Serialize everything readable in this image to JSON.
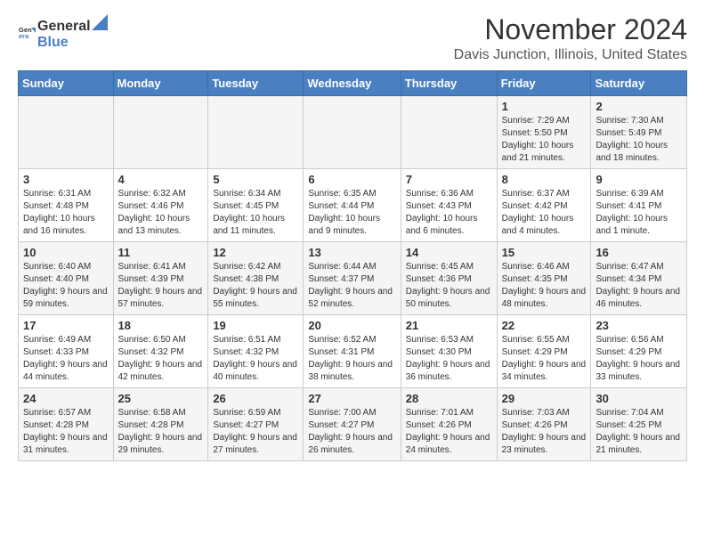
{
  "logo": {
    "text_general": "General",
    "text_blue": "Blue"
  },
  "title": "November 2024",
  "subtitle": "Davis Junction, Illinois, United States",
  "weekdays": [
    "Sunday",
    "Monday",
    "Tuesday",
    "Wednesday",
    "Thursday",
    "Friday",
    "Saturday"
  ],
  "weeks": [
    [
      {
        "day": "",
        "info": ""
      },
      {
        "day": "",
        "info": ""
      },
      {
        "day": "",
        "info": ""
      },
      {
        "day": "",
        "info": ""
      },
      {
        "day": "",
        "info": ""
      },
      {
        "day": "1",
        "info": "Sunrise: 7:29 AM\nSunset: 5:50 PM\nDaylight: 10 hours and 21 minutes."
      },
      {
        "day": "2",
        "info": "Sunrise: 7:30 AM\nSunset: 5:49 PM\nDaylight: 10 hours and 18 minutes."
      }
    ],
    [
      {
        "day": "3",
        "info": "Sunrise: 6:31 AM\nSunset: 4:48 PM\nDaylight: 10 hours and 16 minutes."
      },
      {
        "day": "4",
        "info": "Sunrise: 6:32 AM\nSunset: 4:46 PM\nDaylight: 10 hours and 13 minutes."
      },
      {
        "day": "5",
        "info": "Sunrise: 6:34 AM\nSunset: 4:45 PM\nDaylight: 10 hours and 11 minutes."
      },
      {
        "day": "6",
        "info": "Sunrise: 6:35 AM\nSunset: 4:44 PM\nDaylight: 10 hours and 9 minutes."
      },
      {
        "day": "7",
        "info": "Sunrise: 6:36 AM\nSunset: 4:43 PM\nDaylight: 10 hours and 6 minutes."
      },
      {
        "day": "8",
        "info": "Sunrise: 6:37 AM\nSunset: 4:42 PM\nDaylight: 10 hours and 4 minutes."
      },
      {
        "day": "9",
        "info": "Sunrise: 6:39 AM\nSunset: 4:41 PM\nDaylight: 10 hours and 1 minute."
      }
    ],
    [
      {
        "day": "10",
        "info": "Sunrise: 6:40 AM\nSunset: 4:40 PM\nDaylight: 9 hours and 59 minutes."
      },
      {
        "day": "11",
        "info": "Sunrise: 6:41 AM\nSunset: 4:39 PM\nDaylight: 9 hours and 57 minutes."
      },
      {
        "day": "12",
        "info": "Sunrise: 6:42 AM\nSunset: 4:38 PM\nDaylight: 9 hours and 55 minutes."
      },
      {
        "day": "13",
        "info": "Sunrise: 6:44 AM\nSunset: 4:37 PM\nDaylight: 9 hours and 52 minutes."
      },
      {
        "day": "14",
        "info": "Sunrise: 6:45 AM\nSunset: 4:36 PM\nDaylight: 9 hours and 50 minutes."
      },
      {
        "day": "15",
        "info": "Sunrise: 6:46 AM\nSunset: 4:35 PM\nDaylight: 9 hours and 48 minutes."
      },
      {
        "day": "16",
        "info": "Sunrise: 6:47 AM\nSunset: 4:34 PM\nDaylight: 9 hours and 46 minutes."
      }
    ],
    [
      {
        "day": "17",
        "info": "Sunrise: 6:49 AM\nSunset: 4:33 PM\nDaylight: 9 hours and 44 minutes."
      },
      {
        "day": "18",
        "info": "Sunrise: 6:50 AM\nSunset: 4:32 PM\nDaylight: 9 hours and 42 minutes."
      },
      {
        "day": "19",
        "info": "Sunrise: 6:51 AM\nSunset: 4:32 PM\nDaylight: 9 hours and 40 minutes."
      },
      {
        "day": "20",
        "info": "Sunrise: 6:52 AM\nSunset: 4:31 PM\nDaylight: 9 hours and 38 minutes."
      },
      {
        "day": "21",
        "info": "Sunrise: 6:53 AM\nSunset: 4:30 PM\nDaylight: 9 hours and 36 minutes."
      },
      {
        "day": "22",
        "info": "Sunrise: 6:55 AM\nSunset: 4:29 PM\nDaylight: 9 hours and 34 minutes."
      },
      {
        "day": "23",
        "info": "Sunrise: 6:56 AM\nSunset: 4:29 PM\nDaylight: 9 hours and 33 minutes."
      }
    ],
    [
      {
        "day": "24",
        "info": "Sunrise: 6:57 AM\nSunset: 4:28 PM\nDaylight: 9 hours and 31 minutes."
      },
      {
        "day": "25",
        "info": "Sunrise: 6:58 AM\nSunset: 4:28 PM\nDaylight: 9 hours and 29 minutes."
      },
      {
        "day": "26",
        "info": "Sunrise: 6:59 AM\nSunset: 4:27 PM\nDaylight: 9 hours and 27 minutes."
      },
      {
        "day": "27",
        "info": "Sunrise: 7:00 AM\nSunset: 4:27 PM\nDaylight: 9 hours and 26 minutes."
      },
      {
        "day": "28",
        "info": "Sunrise: 7:01 AM\nSunset: 4:26 PM\nDaylight: 9 hours and 24 minutes."
      },
      {
        "day": "29",
        "info": "Sunrise: 7:03 AM\nSunset: 4:26 PM\nDaylight: 9 hours and 23 minutes."
      },
      {
        "day": "30",
        "info": "Sunrise: 7:04 AM\nSunset: 4:25 PM\nDaylight: 9 hours and 21 minutes."
      }
    ]
  ]
}
